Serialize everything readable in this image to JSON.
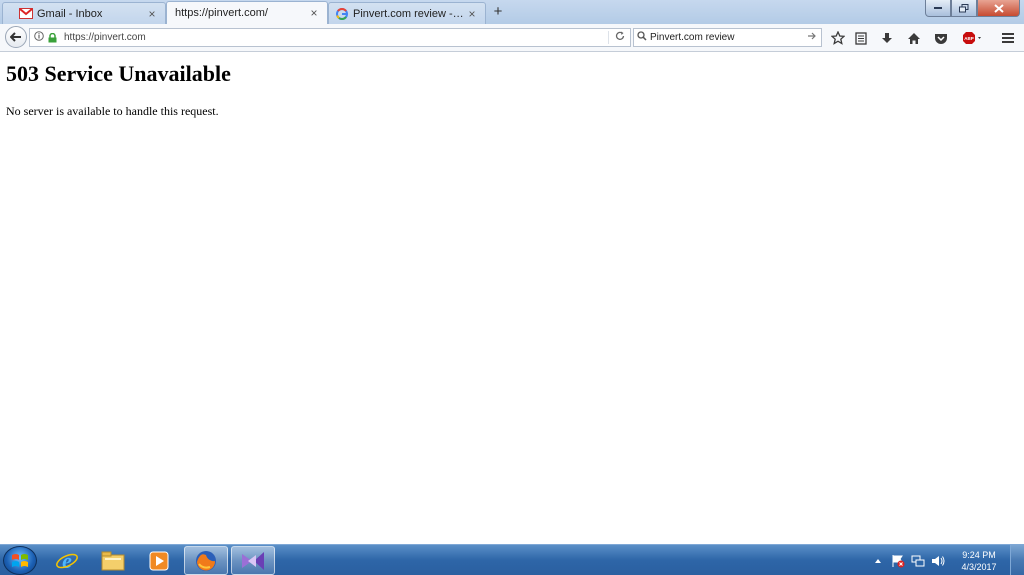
{
  "tabs": [
    {
      "title": "Gmail - Inbox",
      "icon": "gmail-icon",
      "active": false
    },
    {
      "title": "https://pinvert.com/",
      "icon": "",
      "active": true
    },
    {
      "title": "Pinvert.com review - Goog...",
      "icon": "google-icon",
      "active": false
    }
  ],
  "tab_close_glyph": "×",
  "new_tab_glyph": "+",
  "nav": {
    "url": "https://pinvert.com",
    "search_value": "Pinvert.com review"
  },
  "page": {
    "heading": "503 Service Unavailable",
    "message": "No server is available to handle this request."
  },
  "taskbar": {
    "time": "9:24 PM",
    "date": "4/3/2017",
    "apps": [
      "internet-explorer-icon",
      "file-explorer-icon",
      "media-player-icon",
      "firefox-icon",
      "visual-studio-icon"
    ]
  },
  "colors": {
    "abp_red": "#c70d0d",
    "lock_green": "#3aa13a",
    "taskbar_blue": "#2e66a8"
  }
}
